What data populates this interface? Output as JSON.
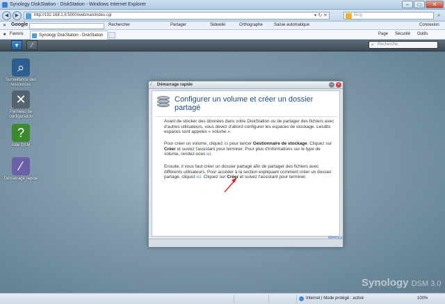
{
  "window": {
    "title": "Synology DiskStation - DiskStation - Windows Internet Explorer",
    "controls": [
      "–",
      "□",
      "✕"
    ]
  },
  "address_bar": {
    "url": "http://192.168.1.6:5000/webman/index.cgi",
    "search_placeholder": "Bing"
  },
  "google_toolbar": {
    "logo": "Google",
    "items": [
      "Rechercher",
      "Partager",
      "Sidewiki",
      "Orthographe",
      "Saisie automatique",
      "Connexion"
    ]
  },
  "favorites_bar": {
    "favorites_label": "Favoris",
    "tab_label": "Synology DiskStation - DiskStation",
    "tools": [
      "Page",
      "Sécurité",
      "Outils"
    ]
  },
  "dsm": {
    "search_placeholder": "Recherche",
    "brand": "Synology",
    "version": "DSM 3.0",
    "desktop_icons": [
      {
        "label": "Surveillance des ressources",
        "icon": "magnifier-icon"
      },
      {
        "label": "Panneau de configuration",
        "icon": "tools-icon"
      },
      {
        "label": "Aide DSM",
        "icon": "help-icon"
      },
      {
        "label": "Démarrage rapide",
        "icon": "wand-icon"
      }
    ]
  },
  "dialog": {
    "window_title": "Démarrage rapide",
    "heading": "Configurer un volume et créer un dossier partagé",
    "p1": "Avant de stocker des données dans votre DiskStation ou de partager des fichiers avec d'autres utilisateurs, vous devez d'abord configurer les espaces de stockage. Lesdits espaces sont appelés « volume ».",
    "p2_a": "Pour créer un volume, cliquez ",
    "p2_link1": "ici",
    "p2_b": " pour lancer ",
    "p2_bold1": "Gestionnaire de stockage",
    "p2_c": ". Cliquez sur ",
    "p2_bold2": "Créer",
    "p2_d": " et suivez l'assistant pour terminer. Pour plus d'informations sur le type de volume, rendez-vous ",
    "p2_link2": "ici",
    "p2_e": ".",
    "p3_a": "Ensuite, il vous faut créer un dossier partagé afin de partager des fichiers avec différents utilisateurs. Pour accéder à la section expliquant comment créer un dossier partagé, cliquez ",
    "p3_link": "ici",
    "p3_b": ". Cliquez sur ",
    "p3_bold": "Créer",
    "p3_c": " et suivez l'assistant pour terminer.",
    "back_label": "Retour"
  },
  "status_bar": {
    "zone": "Internet | Mode protégé : activé",
    "zoom": "100%"
  },
  "colors": {
    "accent": "#1f4d78",
    "link": "#2a6bb2",
    "annotation_arrow": "#e02020"
  }
}
